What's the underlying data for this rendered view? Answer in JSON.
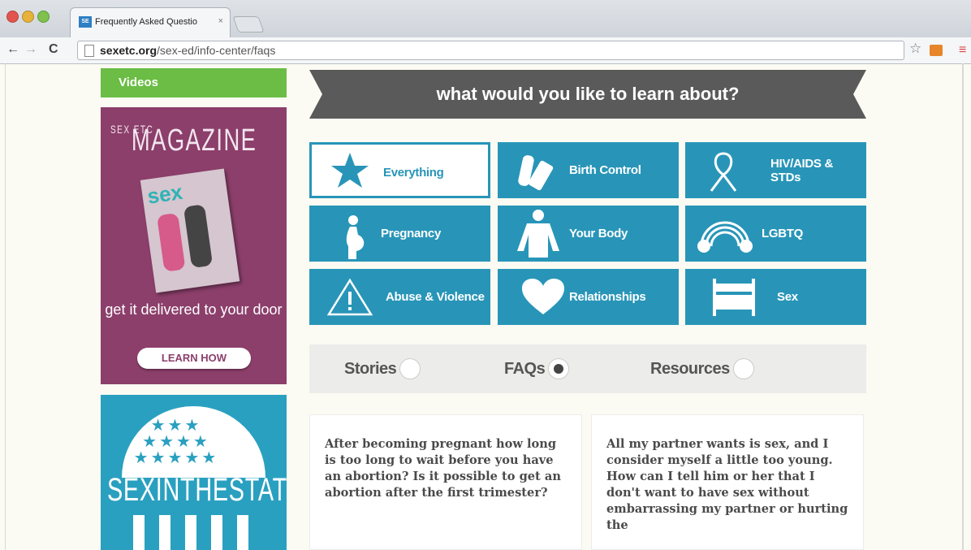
{
  "browser": {
    "tab_title": "Frequently Asked Questio",
    "tab_close": "×",
    "favicon_text": "SE",
    "url_domain": "sexetc.org",
    "url_path": "/sex-ed/info-center/faqs",
    "icons": [
      "close-window-icon",
      "minimize-icon",
      "maximize-icon",
      "back-icon",
      "forward-icon",
      "reload-icon",
      "bookmark-star-icon",
      "extension-icon",
      "menu-icon"
    ]
  },
  "sidebar": {
    "videos_label": "Videos",
    "magazine": {
      "title_small": "SEX ETC",
      "title": "MAGAZINE",
      "cover_logo": "sex",
      "tagline": "get it delivered to your door",
      "button": "LEARN HOW"
    },
    "states": {
      "title": "SEXINTHESTATES"
    }
  },
  "main": {
    "banner": "what would you like to learn about?",
    "topics": [
      {
        "label": "Everything",
        "icon": "star-icon",
        "active": true
      },
      {
        "label": "Birth Control",
        "icon": "birth-control-icon",
        "active": false
      },
      {
        "label": "HIV/AIDS & STDs",
        "icon": "awareness-ribbon-icon",
        "active": false
      },
      {
        "label": "Pregnancy",
        "icon": "pregnant-person-icon",
        "active": false
      },
      {
        "label": "Your Body",
        "icon": "body-icon",
        "active": false
      },
      {
        "label": "LGBTQ",
        "icon": "rainbow-icon",
        "active": false
      },
      {
        "label": "Abuse & Violence",
        "icon": "warning-icon",
        "active": false
      },
      {
        "label": "Relationships",
        "icon": "heart-icon",
        "active": false
      },
      {
        "label": "Sex",
        "icon": "bed-icon",
        "active": false
      }
    ],
    "filters": [
      {
        "label": "Stories",
        "selected": false
      },
      {
        "label": "FAQs",
        "selected": true
      },
      {
        "label": "Resources",
        "selected": false
      }
    ],
    "faqs": [
      {
        "question": "After becoming pregnant how long is too long to wait before you have an abortion? Is it possible to get an abortion after the first trimester?"
      },
      {
        "question": "All my partner wants is sex, and I consider myself a little too young. How can I tell him or her that I don't want to have sex without embarrassing my partner or hurting the"
      }
    ]
  },
  "colors": {
    "tile_blue": "#2895b8",
    "banner_gray": "#5a5a5a",
    "green": "#6bbd45",
    "magazine_purple": "#8c3f6b",
    "states_blue": "#2aa0c0"
  }
}
